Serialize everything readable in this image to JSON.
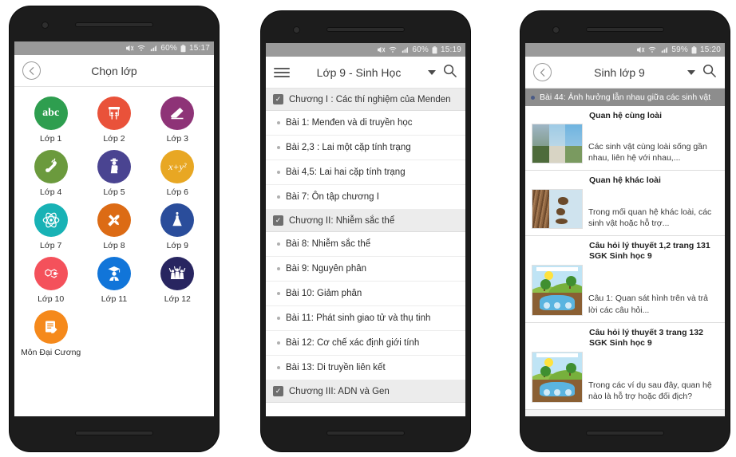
{
  "phone1": {
    "status": {
      "mute_icon": "mute-icon",
      "wifi_icon": "wifi-icon",
      "signal_icon": "signal-icon",
      "battery_pct": "60%",
      "battery_icon": "battery-icon",
      "time": "15:17"
    },
    "appbar": {
      "back_icon": "back-arrow-icon",
      "title": "Chọn lớp"
    },
    "grid": [
      {
        "label": "Lớp 1",
        "color": "#2E9E4F",
        "icon": "abc-icon",
        "glyph": "abc"
      },
      {
        "label": "Lớp 2",
        "color": "#E9523A",
        "icon": "playground-icon",
        "glyph": "playground"
      },
      {
        "label": "Lớp 3",
        "color": "#8E3377",
        "icon": "eraser-icon",
        "glyph": "eraser"
      },
      {
        "label": "Lớp 4",
        "color": "#6B9A3D",
        "icon": "scroll-icon",
        "glyph": "scroll"
      },
      {
        "label": "Lớp 5",
        "color": "#4A4491",
        "icon": "student-icon",
        "glyph": "student"
      },
      {
        "label": "Lớp 6",
        "color": "#E8A723",
        "icon": "algebra-icon",
        "glyph": "x+y²"
      },
      {
        "label": "Lớp 7",
        "color": "#18B2B5",
        "icon": "atom-icon",
        "glyph": "atom"
      },
      {
        "label": "Lớp 8",
        "color": "#DC6B15",
        "icon": "pencil-ruler-icon",
        "glyph": "pencil-ruler"
      },
      {
        "label": "Lớp 9",
        "color": "#2A4D9B",
        "icon": "flask-icon",
        "glyph": "flask"
      },
      {
        "label": "Lớp 10",
        "color": "#F4515B",
        "icon": "molecule-icon",
        "glyph": "molecule"
      },
      {
        "label": "Lớp 11",
        "color": "#1175D9",
        "icon": "graduate-icon",
        "glyph": "graduate"
      },
      {
        "label": "Lớp 12",
        "color": "#282560",
        "icon": "group-icon",
        "glyph": "group"
      },
      {
        "label": "Môn Đại Cương",
        "color": "#F5891B",
        "icon": "notes-icon",
        "glyph": "notes"
      }
    ]
  },
  "phone2": {
    "status": {
      "battery_pct": "60%",
      "time": "15:19"
    },
    "appbar": {
      "menu_icon": "hamburger-icon",
      "title": "Lớp 9 - Sinh Học",
      "caret_icon": "chevron-down-icon",
      "search_icon": "search-icon"
    },
    "list": [
      {
        "type": "chapter",
        "text": "Chương I : Các thí nghiệm của Menden"
      },
      {
        "type": "lesson",
        "text": "Bài 1: Menđen và di truyền học"
      },
      {
        "type": "lesson",
        "text": "Bài 2,3 : Lai một cặp tính trạng"
      },
      {
        "type": "lesson",
        "text": "Bài 4,5: Lai hai cặp tính trạng"
      },
      {
        "type": "lesson",
        "text": "Bài 7: Ôn tập chương I"
      },
      {
        "type": "chapter",
        "text": "Chương II:  Nhiễm sắc thể"
      },
      {
        "type": "lesson",
        "text": "Bài 8: Nhiễm sắc thể"
      },
      {
        "type": "lesson",
        "text": "Bài 9: Nguyên phân"
      },
      {
        "type": "lesson",
        "text": "Bài 10: Giảm phân"
      },
      {
        "type": "lesson",
        "text": "Bài 11: Phát sinh giao tử và thụ tinh"
      },
      {
        "type": "lesson",
        "text": "Bài 12: Cơ chế xác định giới tính"
      },
      {
        "type": "lesson",
        "text": "Bài 13: Di truyền liên kết"
      },
      {
        "type": "chapter",
        "text": "Chương III: ADN và Gen"
      }
    ]
  },
  "phone3": {
    "status": {
      "battery_pct": "59%",
      "time": "15:20"
    },
    "appbar": {
      "back_icon": "back-arrow-icon",
      "title": "Sinh lớp 9",
      "caret_icon": "chevron-down-icon",
      "search_icon": "search-icon"
    },
    "topic": "Bài 44: Ảnh hưởng lẫn nhau giữa các sinh vật",
    "cards": [
      {
        "title": "Quan hệ cùng loài",
        "desc": "Các sinh vật cùng loài sống gần nhau, liên hệ với nhau,...",
        "thumb": "three-photos-thumbnail"
      },
      {
        "title": "Quan hệ khác loài",
        "desc": "Trong mối quan hệ khác loài, các sinh vật hoặc hỗ trợ...",
        "thumb": "tree-bark-thumbnail"
      },
      {
        "title": "Câu hỏi lý thuyết 1,2 trang 131 SGK Sinh học 9",
        "desc": "Câu 1: Quan sát hình trên và trả lời các câu hỏi...",
        "thumb": "ecosystem-thumbnail"
      },
      {
        "title": "Câu hỏi lý thuyết 3 trang 132 SGK Sinh học 9",
        "desc": "Trong các ví dụ sau đây, quan hệ nào là hỗ trợ hoặc đối địch?",
        "thumb": "ecosystem-thumbnail"
      }
    ]
  }
}
